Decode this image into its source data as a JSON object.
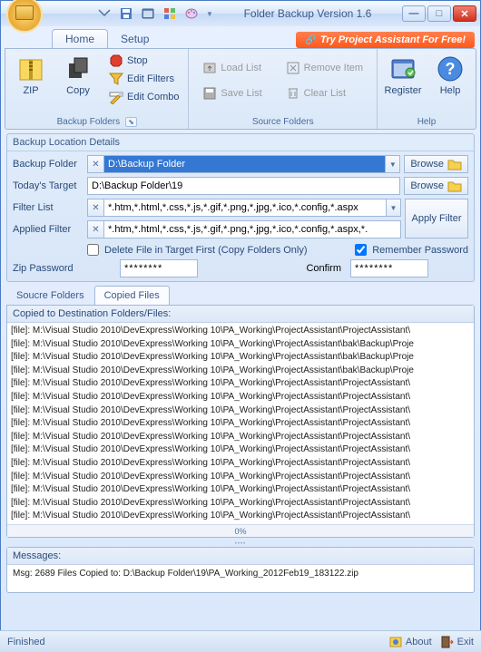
{
  "window": {
    "title": "Folder Backup Version 1.6"
  },
  "promo": "Try Project Assistant For Free!",
  "tabs": {
    "home": "Home",
    "setup": "Setup"
  },
  "ribbon": {
    "groups": {
      "backup": {
        "title": "Backup Folders",
        "zip": "ZIP",
        "copy": "Copy",
        "stop": "Stop",
        "edit_filters": "Edit Filters",
        "edit_combo": "Edit Combo"
      },
      "source": {
        "title": "Source Folders",
        "load_list": "Load List",
        "save_list": "Save List",
        "remove_item": "Remove Item",
        "clear_list": "Clear List"
      },
      "help": {
        "title": "Help",
        "register": "Register",
        "help": "Help"
      }
    }
  },
  "details": {
    "header": "Backup Location Details",
    "backup_folder_label": "Backup Folder",
    "backup_folder_value": "D:\\Backup Folder",
    "todays_target_label": "Today's Target",
    "todays_target_value": "D:\\Backup Folder\\19",
    "filter_list_label": "Filter List",
    "filter_list_value": "*.htm,*.html,*.css,*.js,*.gif,*.png,*.jpg,*.ico,*.config,*.aspx",
    "applied_filter_label": "Applied Filter",
    "applied_filter_value": "*.htm,*.html,*.css,*.js,*.gif,*.png,*.jpg,*.ico,*.config,*.aspx,*.",
    "browse": "Browse",
    "apply_filter": "Apply Filter",
    "delete_first": "Delete File in Target First (Copy Folders Only)",
    "remember_pw": "Remember Password",
    "zip_pw_label": "Zip Password",
    "zip_pw_value": "********",
    "confirm_label": "Confirm",
    "confirm_value": "********"
  },
  "sub_tabs": {
    "source": "Soucre Folders",
    "copied": "Copied Files"
  },
  "files": {
    "header": "Copied to Destination Folders/Files:",
    "lines": [
      "[file]: M:\\Visual Studio 2010\\DevExpress\\Working 10\\PA_Working\\ProjectAssistant\\ProjectAssistant\\",
      "[file]: M:\\Visual Studio 2010\\DevExpress\\Working 10\\PA_Working\\ProjectAssistant\\bak\\Backup\\Proje",
      "[file]: M:\\Visual Studio 2010\\DevExpress\\Working 10\\PA_Working\\ProjectAssistant\\bak\\Backup\\Proje",
      "[file]: M:\\Visual Studio 2010\\DevExpress\\Working 10\\PA_Working\\ProjectAssistant\\bak\\Backup\\Proje",
      "[file]: M:\\Visual Studio 2010\\DevExpress\\Working 10\\PA_Working\\ProjectAssistant\\ProjectAssistant\\",
      "[file]: M:\\Visual Studio 2010\\DevExpress\\Working 10\\PA_Working\\ProjectAssistant\\ProjectAssistant\\",
      "[file]: M:\\Visual Studio 2010\\DevExpress\\Working 10\\PA_Working\\ProjectAssistant\\ProjectAssistant\\",
      "[file]: M:\\Visual Studio 2010\\DevExpress\\Working 10\\PA_Working\\ProjectAssistant\\ProjectAssistant\\",
      "[file]: M:\\Visual Studio 2010\\DevExpress\\Working 10\\PA_Working\\ProjectAssistant\\ProjectAssistant\\",
      "[file]: M:\\Visual Studio 2010\\DevExpress\\Working 10\\PA_Working\\ProjectAssistant\\ProjectAssistant\\",
      "[file]: M:\\Visual Studio 2010\\DevExpress\\Working 10\\PA_Working\\ProjectAssistant\\ProjectAssistant\\",
      "[file]: M:\\Visual Studio 2010\\DevExpress\\Working 10\\PA_Working\\ProjectAssistant\\ProjectAssistant\\",
      "[file]: M:\\Visual Studio 2010\\DevExpress\\Working 10\\PA_Working\\ProjectAssistant\\ProjectAssistant\\",
      "[file]: M:\\Visual Studio 2010\\DevExpress\\Working 10\\PA_Working\\ProjectAssistant\\ProjectAssistant\\",
      "[file]: M:\\Visual Studio 2010\\DevExpress\\Working 10\\PA_Working\\ProjectAssistant\\ProjectAssistant\\"
    ],
    "progress": "0%"
  },
  "messages": {
    "header": "Messages:",
    "text": "Msg: 2689 Files Copied to: D:\\Backup Folder\\19\\PA_Working_2012Feb19_183122.zip"
  },
  "status": {
    "left": "Finished",
    "about": "About",
    "exit": "Exit"
  }
}
